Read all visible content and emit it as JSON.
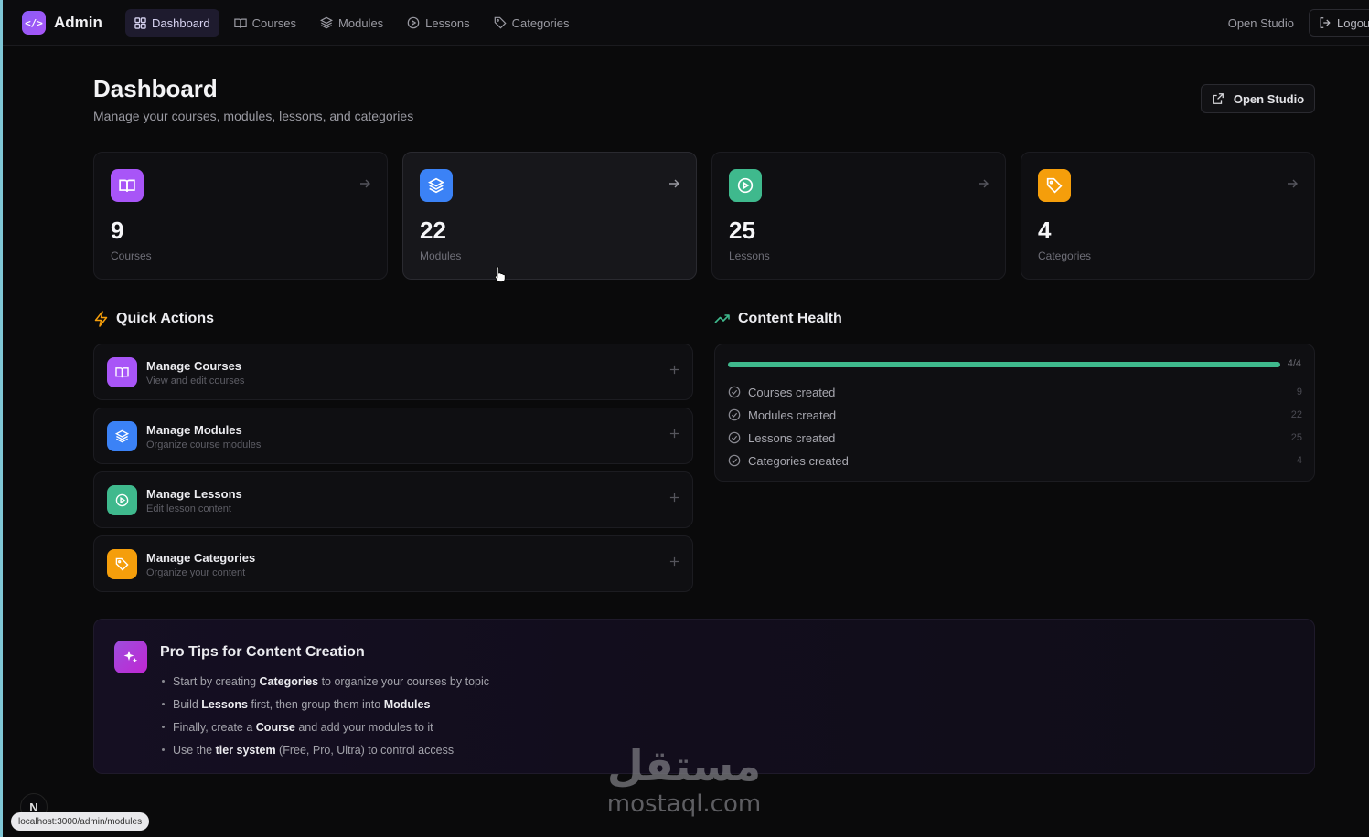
{
  "nav": {
    "brand": "Admin",
    "items": [
      {
        "label": "Dashboard",
        "icon": "grid-icon",
        "active": true
      },
      {
        "label": "Courses",
        "icon": "book-icon",
        "active": false
      },
      {
        "label": "Modules",
        "icon": "layers-icon",
        "active": false
      },
      {
        "label": "Lessons",
        "icon": "play-circle-icon",
        "active": false
      },
      {
        "label": "Categories",
        "icon": "tag-icon",
        "active": false
      }
    ],
    "open_studio": "Open Studio",
    "logout": "Logout"
  },
  "header": {
    "title": "Dashboard",
    "subtitle": "Manage your courses, modules, lessons, and categories",
    "studio_button": "Open Studio"
  },
  "stats": [
    {
      "value": "9",
      "label": "Courses",
      "color": "#a855f7",
      "icon": "book-icon"
    },
    {
      "value": "22",
      "label": "Modules",
      "color": "#3b82f6",
      "icon": "layers-icon"
    },
    {
      "value": "25",
      "label": "Lessons",
      "color": "#3fb98d",
      "icon": "play-circle-icon"
    },
    {
      "value": "4",
      "label": "Categories",
      "color": "#f59e0b",
      "icon": "tag-icon"
    }
  ],
  "quick_actions": {
    "title": "Quick Actions",
    "items": [
      {
        "title": "Manage Courses",
        "desc": "View and edit courses",
        "color": "#a855f7"
      },
      {
        "title": "Manage Modules",
        "desc": "Organize course modules",
        "color": "#3b82f6"
      },
      {
        "title": "Manage Lessons",
        "desc": "Edit lesson content",
        "color": "#3fb98d"
      },
      {
        "title": "Manage Categories",
        "desc": "Organize your content",
        "color": "#f59e0b"
      }
    ]
  },
  "content_health": {
    "title": "Content Health",
    "progress_label": "4/4",
    "progress_fraction": 1.0,
    "rows": [
      {
        "label": "Courses created",
        "count": "9"
      },
      {
        "label": "Modules created",
        "count": "22"
      },
      {
        "label": "Lessons created",
        "count": "25"
      },
      {
        "label": "Categories created",
        "count": "4"
      }
    ]
  },
  "tips": {
    "title": "Pro Tips for Content Creation",
    "items": [
      {
        "pre": "Start by creating ",
        "b1": "Categories",
        "mid": " to organize your courses by topic",
        "b2": "",
        "post": ""
      },
      {
        "pre": "Build ",
        "b1": "Lessons",
        "mid": " first, then group them into ",
        "b2": "Modules",
        "post": ""
      },
      {
        "pre": "Finally, create a ",
        "b1": "Course",
        "mid": " and add your modules to it",
        "b2": "",
        "post": ""
      },
      {
        "pre": "Use the ",
        "b1": "tier system",
        "mid": " (Free, Pro, Ultra) to control access",
        "b2": "",
        "post": ""
      }
    ]
  },
  "status_url": "localhost:3000/admin/modules",
  "next_badge": "N",
  "watermark": {
    "arabic": "مستقل",
    "latin": "mostaql.com"
  }
}
